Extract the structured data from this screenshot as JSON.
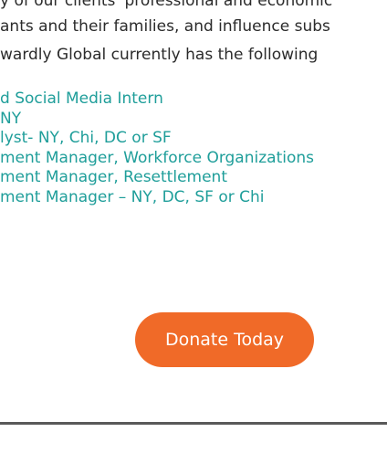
{
  "intro": {
    "line0": "y of our clients' professional and economic",
    "line1": "ants and their families, and influence subs",
    "line2": "wardly Global currently has the following"
  },
  "jobs": [
    "d Social Media Intern",
    " NY",
    "lyst- NY, Chi, DC or SF",
    "ment Manager, Workforce Organizations",
    "ment Manager, Resettlement",
    "ment Manager – NY, DC, SF or Chi"
  ],
  "donate": {
    "label": "Donate Today",
    "color": "#f06a28"
  },
  "colors": {
    "link": "#1f9e9a",
    "text": "#2b2b2b",
    "footer_rule": "#595959"
  }
}
